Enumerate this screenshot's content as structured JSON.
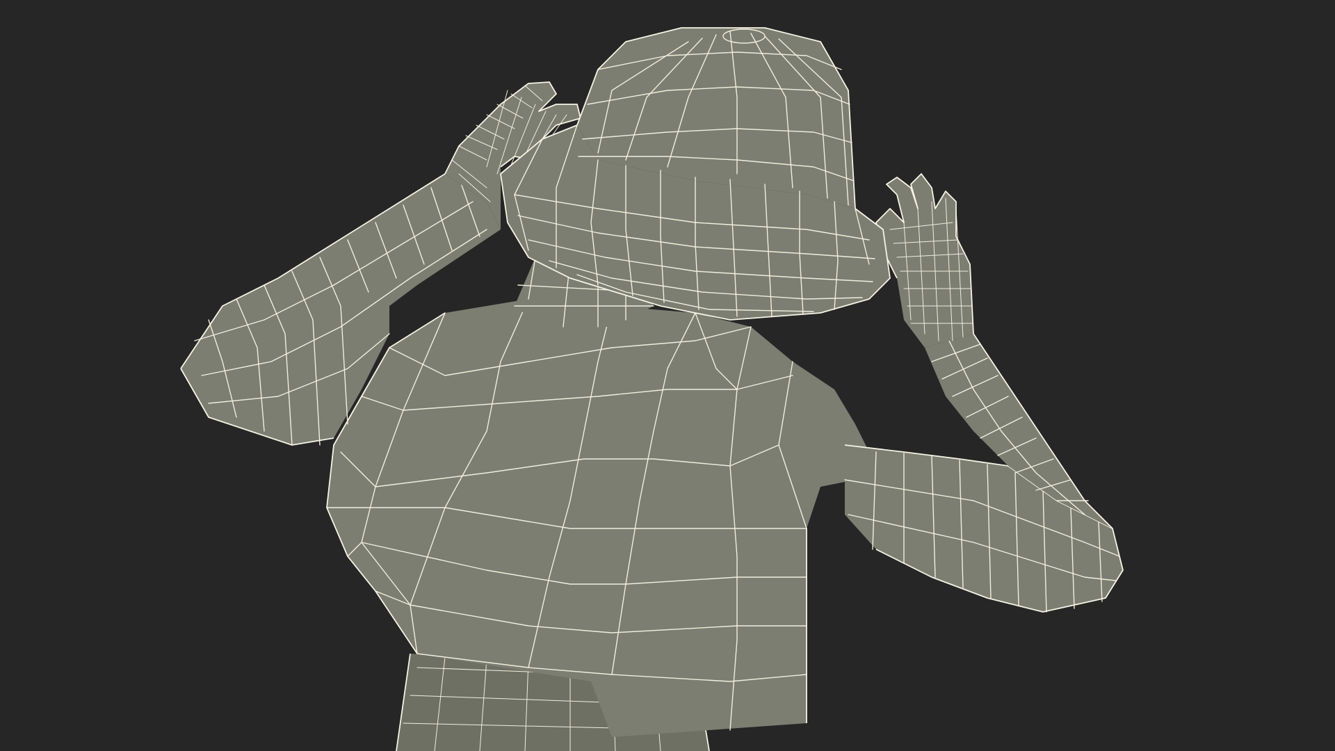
{
  "scene": {
    "background_color": "#262626",
    "mesh_color": "#7c7e72",
    "wire_color": "#f1efdc",
    "subject": "wireframe-figure-adjusting-bucket-hat"
  }
}
